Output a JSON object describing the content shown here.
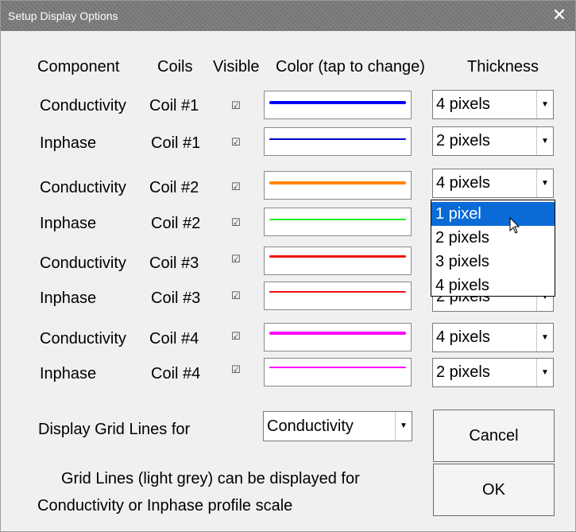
{
  "window": {
    "title": "Setup Display Options",
    "close_glyph": "✕"
  },
  "headers": {
    "component": "Component",
    "coils": "Coils",
    "visible": "Visible",
    "color": "Color (tap to change)",
    "thickness": "Thickness"
  },
  "rows": [
    {
      "component": "Conductivity",
      "coil": "Coil #1",
      "visible": true,
      "color": "#0000ff",
      "thickness": "4 pixels"
    },
    {
      "component": "Inphase",
      "coil": "Coil #1",
      "visible": true,
      "color": "#0000cc",
      "thickness": "2 pixels"
    },
    {
      "component": "Conductivity",
      "coil": "Coil #2",
      "visible": true,
      "color": "#ff8800",
      "thickness": "4 pixels"
    },
    {
      "component": "Inphase",
      "coil": "Coil #2",
      "visible": true,
      "color": "#22ee22",
      "thickness": "1 pixel"
    },
    {
      "component": "Conductivity",
      "coil": "Coil #3",
      "visible": true,
      "color": "#ee1111",
      "thickness": "3 pixels"
    },
    {
      "component": "Inphase",
      "coil": "Coil #3",
      "visible": true,
      "color": "#ee1111",
      "thickness": "2 pixels"
    },
    {
      "component": "Conductivity",
      "coil": "Coil #4",
      "visible": true,
      "color": "#ff00ff",
      "thickness": "4 pixels"
    },
    {
      "component": "Inphase",
      "coil": "Coil #4",
      "visible": true,
      "color": "#ff00ff",
      "thickness": "2 pixels"
    }
  ],
  "dropdown": {
    "options": [
      "1 pixel",
      "2 pixels",
      "3 pixels",
      "4 pixels"
    ],
    "highlighted": "1 pixel",
    "hidden_value": "2 pixels"
  },
  "grid": {
    "label": "Display Grid Lines for",
    "value": "Conductivity",
    "note_line1": "Grid Lines (light grey) can be displayed for",
    "note_line2": "Conductivity or Inphase profile scale"
  },
  "buttons": {
    "cancel": "Cancel",
    "ok": "OK"
  },
  "colors": {
    "selection": "#0a6ad6",
    "titlebar": "#7a7a7a"
  }
}
